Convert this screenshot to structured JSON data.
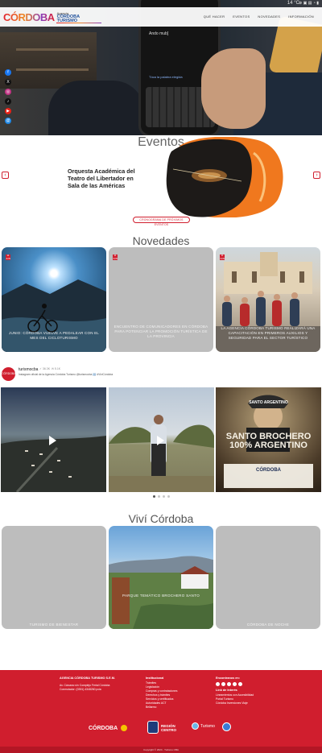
{
  "status_bar": {
    "temperature": "14 °C",
    "icons": "⊕ ▣ ▤ ◔ ▮"
  },
  "header": {
    "logo_word": "CÓRDOBA",
    "logo_agency": "Agencia",
    "logo_name": "CÓRDOBA",
    "logo_sub": "TURISMO",
    "nav": [
      "QUÉ HACER",
      "EVENTOS",
      "NOVEDADES",
      "INFORMACIÓN"
    ]
  },
  "hero": {
    "phone_text": "Ando mub]",
    "phone_hint": "Tóca la palabra elegida"
  },
  "social_icons": [
    "facebook-icon",
    "x-icon",
    "instagram-icon",
    "tiktok-icon",
    "youtube-icon",
    "threads-icon"
  ],
  "events": {
    "title": "Eventos",
    "card_title": "Orquesta Académica del Teatro del Libertador en Sala de las Américas",
    "prev": "‹",
    "next": "›",
    "button": "CRONOGRAMA DE PRÓXIMOS EVENTOS"
  },
  "news": {
    "title": "Novedades",
    "items": [
      {
        "date": "11 JUN",
        "caption": "JUNIO: CÓRDOBA VUELVE A PEDALEAR CON EL MES DEL CICLOTURISMO"
      },
      {
        "date": "11 JUN",
        "caption": "ENCUENTRO DE COMUNICADORES EN CÓRDOBA PARA POTENCIAR LA PROMOCIÓN TURÍSTICA DE LA PROVINCIA"
      },
      {
        "date": "11 JUN",
        "caption": "LA AGENCIA CÓRDOBA TURISMO REALIZARÁ UNA CAPACITACIÓN EN PRIMEROS AUXILIOS Y SEGURIDAD PARA EL SECTOR TURÍSTICO"
      }
    ]
  },
  "instagram": {
    "username": "turismocba",
    "followers": "✓ 36.3K",
    "posts": "✉ 5.1K",
    "bio": "Instagram oficial de la Agencia Córdoba Turismo @turismocba 🇦🇷 #VivíCórdoba",
    "avatar": "CÓRDOBA",
    "posts_overlay": [
      "",
      "",
      "SANTO BROCHERO 100% ARGENTINO"
    ],
    "overlay_top": "SANTO ARGENTINO",
    "overlay_small": "CÓRDOBA"
  },
  "vivi": {
    "title": "Viví Córdoba",
    "items": [
      {
        "caption": "TURISMO DE BIENESTAR"
      },
      {
        "caption": "PARQUE TEMÁTICO BROCHERO SANTO"
      },
      {
        "caption": "CÓRDOBA DE NOCHE"
      }
    ]
  },
  "footer": {
    "agency_title": "AGENCIA CÓRDOBA TURISMO S.E.M.",
    "agency_lines": [
      "Av. Cárcano s/n Complejo Ferial Córdoba",
      "Conmutador: (0351) 4348260 pcia"
    ],
    "inst_title": "Institucional",
    "inst_lines": [
      "Trámites",
      "Legislación",
      "Compras y contrataciones",
      "Derechos y trámites",
      "Servicios y certificados",
      "Autoridades ACT",
      "Bellarmo"
    ],
    "follow_title": "Encontranos en:",
    "links_title": "Link de Interés",
    "links_lines": [
      "Lineamientos con Accesibilidad",
      "Portal Turismo",
      "Córdoba Inversiones Viaje"
    ],
    "logo_left": "CÓRDOBA",
    "logo_region": "REGIÓN CENTRO",
    "logo_turismo": "Turismo",
    "copyright": "Copyright © 2024 · Turismo CBA"
  },
  "colors": {
    "brand_red": "#d01e2e",
    "nav_bg": "#ffffff",
    "tile_gray": "#bdbdbd"
  }
}
